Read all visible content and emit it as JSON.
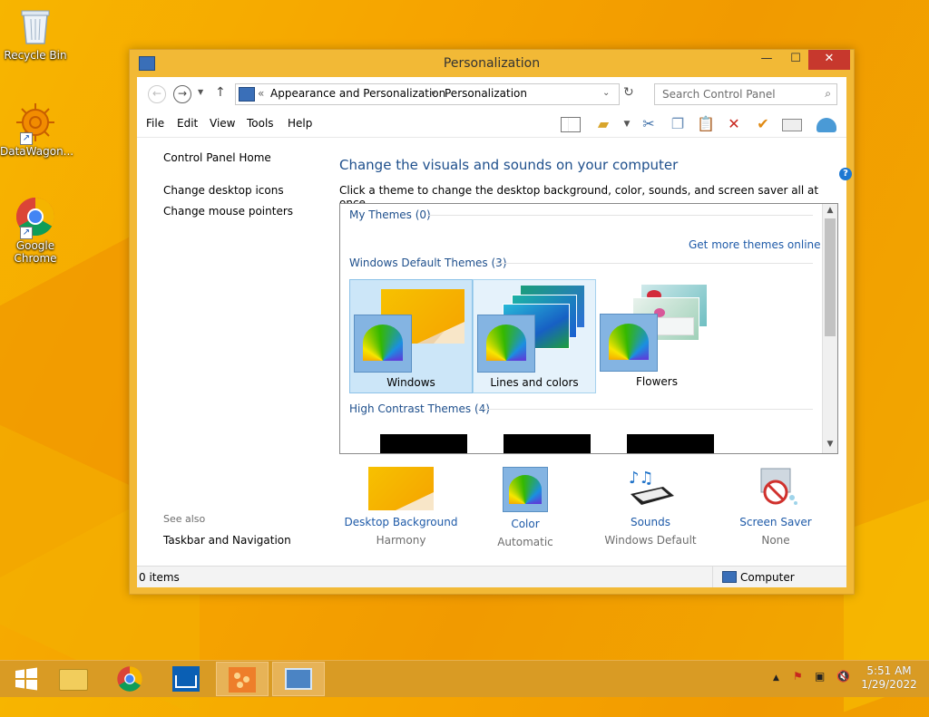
{
  "desktop": {
    "icons": [
      {
        "label": "Recycle Bin"
      },
      {
        "label": "DataWagon..."
      },
      {
        "label": "Google Chrome"
      }
    ]
  },
  "window": {
    "title": "Personalization",
    "controls": {
      "minimize": "—",
      "maximize": "☐",
      "close": "✕"
    },
    "address": {
      "prefix": "«",
      "crumb1": "Appearance and Personalization",
      "sep": "▸",
      "crumb2": "Personalization"
    },
    "search": {
      "placeholder": "Search Control Panel"
    },
    "menu": [
      "File",
      "Edit",
      "View",
      "Tools",
      "Help"
    ],
    "left_pane": {
      "home": "Control Panel Home",
      "links": [
        "Change desktop icons",
        "Change mouse pointers"
      ],
      "see_also_label": "See also",
      "see_also": [
        "Taskbar and Navigation"
      ]
    },
    "heading": "Change the visuals and sounds on your computer",
    "subtext": "Click a theme to change the desktop background, color, sounds, and screen saver all at once.",
    "themes": {
      "my_themes": "My Themes (0)",
      "get_more": "Get more themes online",
      "default_group": "Windows Default Themes (3)",
      "default_themes": [
        "Windows",
        "Lines and colors",
        "Flowers"
      ],
      "high_contrast_group": "High Contrast Themes (4)"
    },
    "bottom": [
      {
        "title": "Desktop Background",
        "value": "Harmony"
      },
      {
        "title": "Color",
        "value": "Automatic"
      },
      {
        "title": "Sounds",
        "value": "Windows Default"
      },
      {
        "title": "Screen Saver",
        "value": "None"
      }
    ],
    "status": {
      "items": "0 items",
      "location": "Computer"
    }
  },
  "taskbar": {
    "time": "5:51 AM",
    "date": "1/29/2022"
  },
  "colors": {
    "accent": "#1e5aa8",
    "heading": "#1e4f8c",
    "desktop": "#f6a800",
    "close": "#c7382d"
  }
}
